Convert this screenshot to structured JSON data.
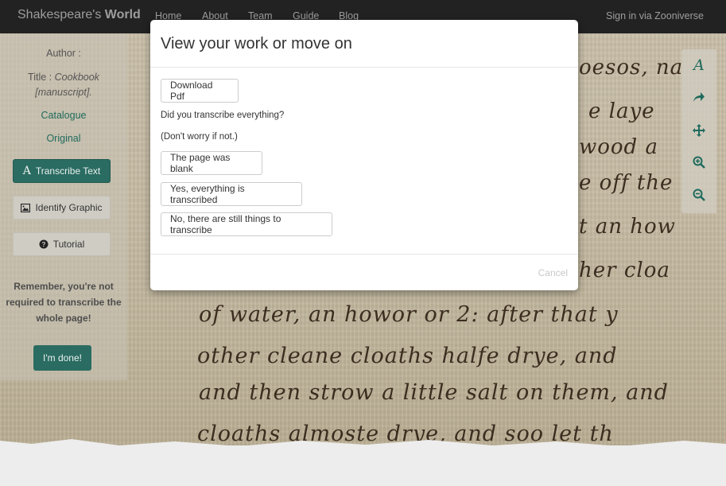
{
  "navbar": {
    "brand_light": "Shakespeare's",
    "brand_bold": "World",
    "links": [
      "Home",
      "About",
      "Team",
      "Guide",
      "Blog"
    ],
    "signin": "Sign in via Zooniverse"
  },
  "left_panel": {
    "author_label": "Author :",
    "title_label": "Title :",
    "title_value": "Cookbook [manuscript].",
    "catalogue": "Catalogue",
    "original": "Original",
    "transcribe_btn": "Transcribe Text",
    "graphic_btn": "Identify Graphic",
    "tutorial_btn": "Tutorial",
    "note": "Remember, you're not required to transcribe the whole page!",
    "done_btn": "I'm done!"
  },
  "toolbar": {
    "icons": [
      "italic-a-icon",
      "share-arrow-icon",
      "move-icon",
      "zoom-in-icon",
      "zoom-out-icon"
    ]
  },
  "manuscript": {
    "lines": [
      "oesos, na",
      "e laye",
      "wood a",
      "e off the",
      "t an how",
      "her cloa",
      "of water, an howor or 2: after that y",
      "other cleane cloaths halfe drye, and",
      "and then strow a little salt on them, and",
      "cloaths almoste drye, and soo let th"
    ]
  },
  "modal": {
    "title": "View your work or move on",
    "download_btn": "Download Pdf",
    "question": "Did you transcribe everything?",
    "subnote": "(Don't worry if not.)",
    "blank_btn": "The page was blank",
    "yes_btn": "Yes, everything is transcribed",
    "no_btn": "No, there are still things to transcribe",
    "cancel_btn": "Cancel"
  },
  "colors": {
    "accent": "#2b6c62",
    "navbar": "#222222",
    "nav_text": "#9d9d9d"
  }
}
